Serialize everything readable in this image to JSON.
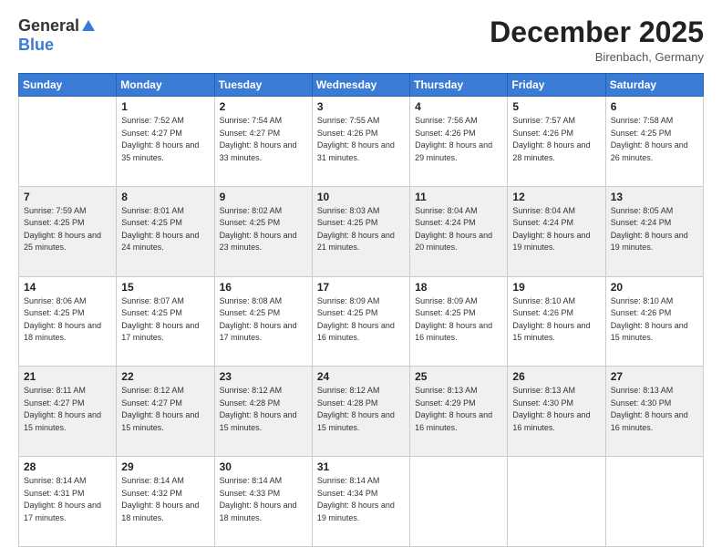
{
  "logo": {
    "general": "General",
    "blue": "Blue"
  },
  "header": {
    "month": "December 2025",
    "location": "Birenbach, Germany"
  },
  "weekdays": [
    "Sunday",
    "Monday",
    "Tuesday",
    "Wednesday",
    "Thursday",
    "Friday",
    "Saturday"
  ],
  "weeks": [
    [
      {
        "day": "",
        "sunrise": "",
        "sunset": "",
        "daylight": ""
      },
      {
        "day": "1",
        "sunrise": "Sunrise: 7:52 AM",
        "sunset": "Sunset: 4:27 PM",
        "daylight": "Daylight: 8 hours and 35 minutes."
      },
      {
        "day": "2",
        "sunrise": "Sunrise: 7:54 AM",
        "sunset": "Sunset: 4:27 PM",
        "daylight": "Daylight: 8 hours and 33 minutes."
      },
      {
        "day": "3",
        "sunrise": "Sunrise: 7:55 AM",
        "sunset": "Sunset: 4:26 PM",
        "daylight": "Daylight: 8 hours and 31 minutes."
      },
      {
        "day": "4",
        "sunrise": "Sunrise: 7:56 AM",
        "sunset": "Sunset: 4:26 PM",
        "daylight": "Daylight: 8 hours and 29 minutes."
      },
      {
        "day": "5",
        "sunrise": "Sunrise: 7:57 AM",
        "sunset": "Sunset: 4:26 PM",
        "daylight": "Daylight: 8 hours and 28 minutes."
      },
      {
        "day": "6",
        "sunrise": "Sunrise: 7:58 AM",
        "sunset": "Sunset: 4:25 PM",
        "daylight": "Daylight: 8 hours and 26 minutes."
      }
    ],
    [
      {
        "day": "7",
        "sunrise": "Sunrise: 7:59 AM",
        "sunset": "Sunset: 4:25 PM",
        "daylight": "Daylight: 8 hours and 25 minutes."
      },
      {
        "day": "8",
        "sunrise": "Sunrise: 8:01 AM",
        "sunset": "Sunset: 4:25 PM",
        "daylight": "Daylight: 8 hours and 24 minutes."
      },
      {
        "day": "9",
        "sunrise": "Sunrise: 8:02 AM",
        "sunset": "Sunset: 4:25 PM",
        "daylight": "Daylight: 8 hours and 23 minutes."
      },
      {
        "day": "10",
        "sunrise": "Sunrise: 8:03 AM",
        "sunset": "Sunset: 4:25 PM",
        "daylight": "Daylight: 8 hours and 21 minutes."
      },
      {
        "day": "11",
        "sunrise": "Sunrise: 8:04 AM",
        "sunset": "Sunset: 4:24 PM",
        "daylight": "Daylight: 8 hours and 20 minutes."
      },
      {
        "day": "12",
        "sunrise": "Sunrise: 8:04 AM",
        "sunset": "Sunset: 4:24 PM",
        "daylight": "Daylight: 8 hours and 19 minutes."
      },
      {
        "day": "13",
        "sunrise": "Sunrise: 8:05 AM",
        "sunset": "Sunset: 4:24 PM",
        "daylight": "Daylight: 8 hours and 19 minutes."
      }
    ],
    [
      {
        "day": "14",
        "sunrise": "Sunrise: 8:06 AM",
        "sunset": "Sunset: 4:25 PM",
        "daylight": "Daylight: 8 hours and 18 minutes."
      },
      {
        "day": "15",
        "sunrise": "Sunrise: 8:07 AM",
        "sunset": "Sunset: 4:25 PM",
        "daylight": "Daylight: 8 hours and 17 minutes."
      },
      {
        "day": "16",
        "sunrise": "Sunrise: 8:08 AM",
        "sunset": "Sunset: 4:25 PM",
        "daylight": "Daylight: 8 hours and 17 minutes."
      },
      {
        "day": "17",
        "sunrise": "Sunrise: 8:09 AM",
        "sunset": "Sunset: 4:25 PM",
        "daylight": "Daylight: 8 hours and 16 minutes."
      },
      {
        "day": "18",
        "sunrise": "Sunrise: 8:09 AM",
        "sunset": "Sunset: 4:25 PM",
        "daylight": "Daylight: 8 hours and 16 minutes."
      },
      {
        "day": "19",
        "sunrise": "Sunrise: 8:10 AM",
        "sunset": "Sunset: 4:26 PM",
        "daylight": "Daylight: 8 hours and 15 minutes."
      },
      {
        "day": "20",
        "sunrise": "Sunrise: 8:10 AM",
        "sunset": "Sunset: 4:26 PM",
        "daylight": "Daylight: 8 hours and 15 minutes."
      }
    ],
    [
      {
        "day": "21",
        "sunrise": "Sunrise: 8:11 AM",
        "sunset": "Sunset: 4:27 PM",
        "daylight": "Daylight: 8 hours and 15 minutes."
      },
      {
        "day": "22",
        "sunrise": "Sunrise: 8:12 AM",
        "sunset": "Sunset: 4:27 PM",
        "daylight": "Daylight: 8 hours and 15 minutes."
      },
      {
        "day": "23",
        "sunrise": "Sunrise: 8:12 AM",
        "sunset": "Sunset: 4:28 PM",
        "daylight": "Daylight: 8 hours and 15 minutes."
      },
      {
        "day": "24",
        "sunrise": "Sunrise: 8:12 AM",
        "sunset": "Sunset: 4:28 PM",
        "daylight": "Daylight: 8 hours and 15 minutes."
      },
      {
        "day": "25",
        "sunrise": "Sunrise: 8:13 AM",
        "sunset": "Sunset: 4:29 PM",
        "daylight": "Daylight: 8 hours and 16 minutes."
      },
      {
        "day": "26",
        "sunrise": "Sunrise: 8:13 AM",
        "sunset": "Sunset: 4:30 PM",
        "daylight": "Daylight: 8 hours and 16 minutes."
      },
      {
        "day": "27",
        "sunrise": "Sunrise: 8:13 AM",
        "sunset": "Sunset: 4:30 PM",
        "daylight": "Daylight: 8 hours and 16 minutes."
      }
    ],
    [
      {
        "day": "28",
        "sunrise": "Sunrise: 8:14 AM",
        "sunset": "Sunset: 4:31 PM",
        "daylight": "Daylight: 8 hours and 17 minutes."
      },
      {
        "day": "29",
        "sunrise": "Sunrise: 8:14 AM",
        "sunset": "Sunset: 4:32 PM",
        "daylight": "Daylight: 8 hours and 18 minutes."
      },
      {
        "day": "30",
        "sunrise": "Sunrise: 8:14 AM",
        "sunset": "Sunset: 4:33 PM",
        "daylight": "Daylight: 8 hours and 18 minutes."
      },
      {
        "day": "31",
        "sunrise": "Sunrise: 8:14 AM",
        "sunset": "Sunset: 4:34 PM",
        "daylight": "Daylight: 8 hours and 19 minutes."
      },
      {
        "day": "",
        "sunrise": "",
        "sunset": "",
        "daylight": ""
      },
      {
        "day": "",
        "sunrise": "",
        "sunset": "",
        "daylight": ""
      },
      {
        "day": "",
        "sunrise": "",
        "sunset": "",
        "daylight": ""
      }
    ]
  ],
  "colors": {
    "header_bg": "#3a7bd5",
    "row_shaded": "#f0f0f0",
    "row_white": "#ffffff"
  }
}
